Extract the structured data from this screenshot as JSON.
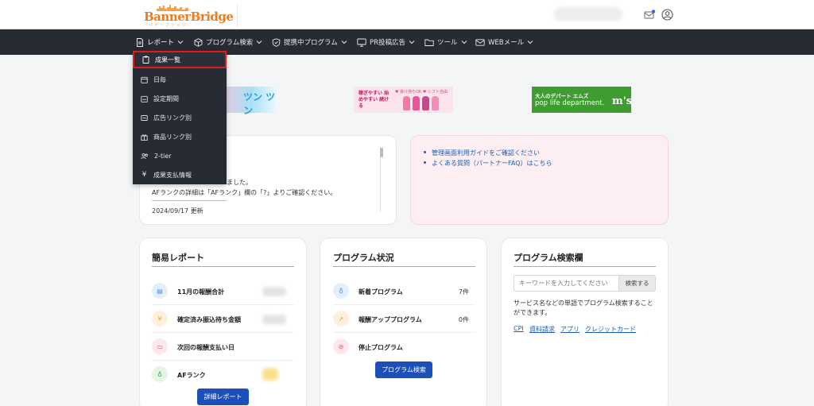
{
  "brand": {
    "logo_main": "BannerBridge",
    "logo_sub": "バナーブリッジ"
  },
  "nav": {
    "items": [
      {
        "label": "レポート",
        "icon": "document-icon"
      },
      {
        "label": "プログラム検索",
        "icon": "cube-icon"
      },
      {
        "label": "提携中プログラム",
        "icon": "shield-icon"
      },
      {
        "label": "PR投稿広告",
        "icon": "monitor-icon"
      },
      {
        "label": "ツール",
        "icon": "folder-icon"
      },
      {
        "label": "WEBメール",
        "icon": "mail-icon"
      }
    ]
  },
  "report_menu": {
    "items": [
      {
        "label": "成果一覧",
        "icon": "clipboard-icon"
      },
      {
        "label": "日毎",
        "icon": "calendar-icon"
      },
      {
        "label": "設定期間",
        "icon": "calendar-range-icon"
      },
      {
        "label": "広告リンク別",
        "icon": "link-card-icon"
      },
      {
        "label": "商品リンク別",
        "icon": "gift-icon"
      },
      {
        "label": "2-tier",
        "icon": "users-icon"
      },
      {
        "label": "成果支払情報",
        "icon": "yen-icon"
      }
    ]
  },
  "banners": {
    "a_text": "ツン ツン",
    "b_text1": "稼ぎやすい 始めやすい 続ける",
    "b_text2": "♥ 掛け持ちOK ♥ シフト自由",
    "c_text1": "大人のデパート エムズ",
    "c_text2": "pop life department.",
    "c_text3": "m's"
  },
  "notice": {
    "line1": "ました。",
    "line2": "AFランクの詳細は「AFランク」欄の「?」よりご確認ください。",
    "divider": "--------------------------------------------------------------------------------",
    "line3": "2024/09/17 更新"
  },
  "guides": {
    "links": [
      "管理画面利用ガイドをご確認ください",
      "よくある質問（パートナーFAQ）はこちら"
    ]
  },
  "simple_report": {
    "title": "簡易レポート",
    "rows": [
      {
        "label": "11月の報酬合計",
        "icon": "receipt-icon"
      },
      {
        "label": "確定済み振込待ち金額",
        "icon": "yen-icon"
      },
      {
        "label": "次回の報酬支払い日",
        "icon": "calendar-icon"
      },
      {
        "label": "AFランク",
        "icon": "bulb-icon"
      }
    ],
    "button": "詳細レポート"
  },
  "program_status": {
    "title": "プログラム状況",
    "rows": [
      {
        "label": "新着プログラム",
        "value": "7件",
        "icon": "bulb-icon"
      },
      {
        "label": "報酬アッププログラム",
        "value": "0件",
        "icon": "chart-up-icon"
      },
      {
        "label": "停止プログラム",
        "value": "",
        "icon": "stop-icon"
      }
    ],
    "button": "プログラム検索"
  },
  "program_search": {
    "title": "プログラム検索欄",
    "placeholder": "キーワードを入力してください",
    "button": "検索する",
    "description": "サービス名などの単語でプログラム検索することができます。",
    "tags": [
      "CPI",
      "資料請求",
      "アプリ",
      "クレジットカード"
    ]
  },
  "colors": {
    "nav_bg": "#272b34",
    "accent": "#e8a23a",
    "primary": "#1c4fb8",
    "highlight": "#e01b1b",
    "logo": "#f07a1a"
  }
}
